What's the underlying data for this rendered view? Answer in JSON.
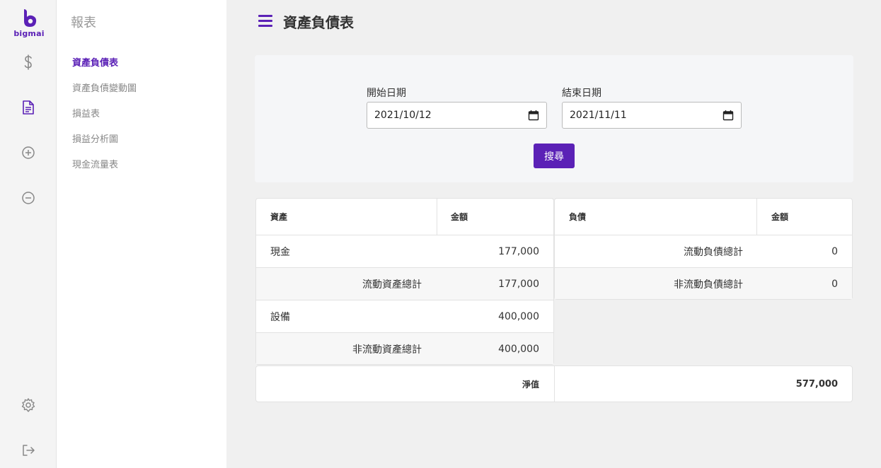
{
  "brand": {
    "name": "bigmai",
    "color": "#5b21b6"
  },
  "rail": {
    "icons": [
      "dollar-icon",
      "document-icon",
      "plus-circle-icon",
      "minus-circle-icon",
      "settings-icon",
      "logout-icon"
    ]
  },
  "subnav": {
    "title": "報表",
    "items": [
      {
        "label": "資產負債表",
        "active": true
      },
      {
        "label": "資產負債變動圖",
        "active": false
      },
      {
        "label": "損益表",
        "active": false
      },
      {
        "label": "損益分析圖",
        "active": false
      },
      {
        "label": "現金流量表",
        "active": false
      }
    ]
  },
  "header": {
    "title": "資產負債表"
  },
  "filter": {
    "start_label": "開始日期",
    "start_value": "2021/10/12",
    "end_label": "結束日期",
    "end_value": "2021/11/11",
    "search_label": "搜尋"
  },
  "assets": {
    "headers": [
      "資產",
      "金額"
    ],
    "rows": [
      {
        "label": "現金",
        "amount": "177,000"
      },
      {
        "label": "流動資產總計",
        "amount": "177,000"
      },
      {
        "label": "設備",
        "amount": "400,000"
      },
      {
        "label": "非流動資產總計",
        "amount": "400,000"
      }
    ]
  },
  "liabilities": {
    "headers": [
      "負債",
      "金額"
    ],
    "rows": [
      {
        "label": "流動負債總計",
        "amount": "0"
      },
      {
        "label": "非流動負債總計",
        "amount": "0"
      }
    ]
  },
  "net_worth": {
    "label": "淨值",
    "amount": "577,000"
  }
}
